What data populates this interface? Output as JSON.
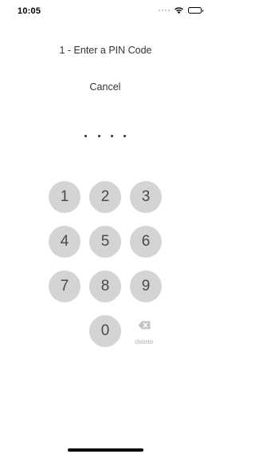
{
  "status_bar": {
    "time": "10:05",
    "icons": [
      "signal-dots-icon",
      "wifi-icon",
      "battery-icon"
    ]
  },
  "pin_screen": {
    "title": "1 - Enter a PIN Code",
    "cancel_label": "Cancel",
    "pin_length": 4,
    "entered_digits": 0
  },
  "keypad": {
    "keys": [
      "1",
      "2",
      "3",
      "4",
      "5",
      "6",
      "7",
      "8",
      "9",
      "0"
    ],
    "delete_label": "delete"
  },
  "colors": {
    "key_background": "#d4d4d4",
    "key_text": "#4a4a4a",
    "delete_tint": "#b3b3b3"
  }
}
